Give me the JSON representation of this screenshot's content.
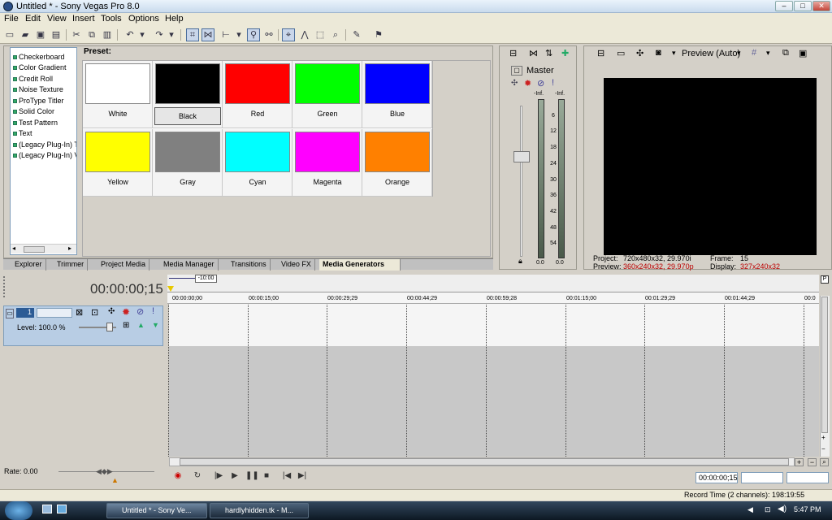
{
  "window": {
    "title": "Untitled * - Sony Vegas Pro 8.0",
    "min": "–",
    "max": "□",
    "close": "✕"
  },
  "menu": [
    "File",
    "Edit",
    "View",
    "Insert",
    "Tools",
    "Options",
    "Help"
  ],
  "generators": [
    "Checkerboard",
    "Color Gradient",
    "Credit Roll",
    "Noise Texture",
    "ProType Titler",
    "Solid Color",
    "Test Pattern",
    "Text",
    "(Legacy Plug-In) T",
    "(Legacy Plug-In) V"
  ],
  "preset_label": "Preset:",
  "presets": [
    {
      "name": "White",
      "color": "#ffffff"
    },
    {
      "name": "Black",
      "color": "#000000"
    },
    {
      "name": "Red",
      "color": "#ff0000"
    },
    {
      "name": "Green",
      "color": "#00ff00"
    },
    {
      "name": "Blue",
      "color": "#0000ff"
    },
    {
      "name": "Yellow",
      "color": "#ffff00"
    },
    {
      "name": "Gray",
      "color": "#808080"
    },
    {
      "name": "Cyan",
      "color": "#00ffff"
    },
    {
      "name": "Magenta",
      "color": "#ff00ff"
    },
    {
      "name": "Orange",
      "color": "#ff8000"
    }
  ],
  "selected_preset": "Black",
  "tabs": [
    "Explorer",
    "Trimmer",
    "Project Media",
    "Media Manager",
    "Transitions",
    "Video FX",
    "Media Generators"
  ],
  "active_tab": "Media Generators",
  "mixer": {
    "label": "Master",
    "peak_l": "-Inf.",
    "peak_r": "-Inf.",
    "scale": [
      "6",
      "12",
      "18",
      "24",
      "30",
      "36",
      "42",
      "48",
      "54"
    ],
    "val_l": "0.0",
    "val_r": "0.0"
  },
  "preview": {
    "quality": "Preview (Auto)",
    "project_label": "Project:",
    "project_val": "720x480x32, 29.970i",
    "preview_label": "Preview:",
    "preview_val": "360x240x32, 29.970p",
    "frame_label": "Frame:",
    "frame_val": "15",
    "display_label": "Display:",
    "display_val": "327x240x32"
  },
  "timeline": {
    "timecode": "00:00:00;15",
    "marker": "-10:00",
    "ruler": [
      "00:00:00;00",
      "00:00:15;00",
      "00:00:29;29",
      "00:00:44;29",
      "00:00:59;28",
      "00:01:15;00",
      "00:01:29;29",
      "00:01:44;29",
      "00:0"
    ],
    "track_num": "1",
    "level": "Level: 100.0 %",
    "rate": "Rate: 0.00",
    "end_time": "00:00:00;15"
  },
  "status": "Record Time (2 channels): 198:19:55",
  "taskbar": {
    "tasks": [
      "Untitled * - Sony Ve...",
      "hardlyhidden.tk - M..."
    ],
    "clock": "5:47 PM"
  }
}
